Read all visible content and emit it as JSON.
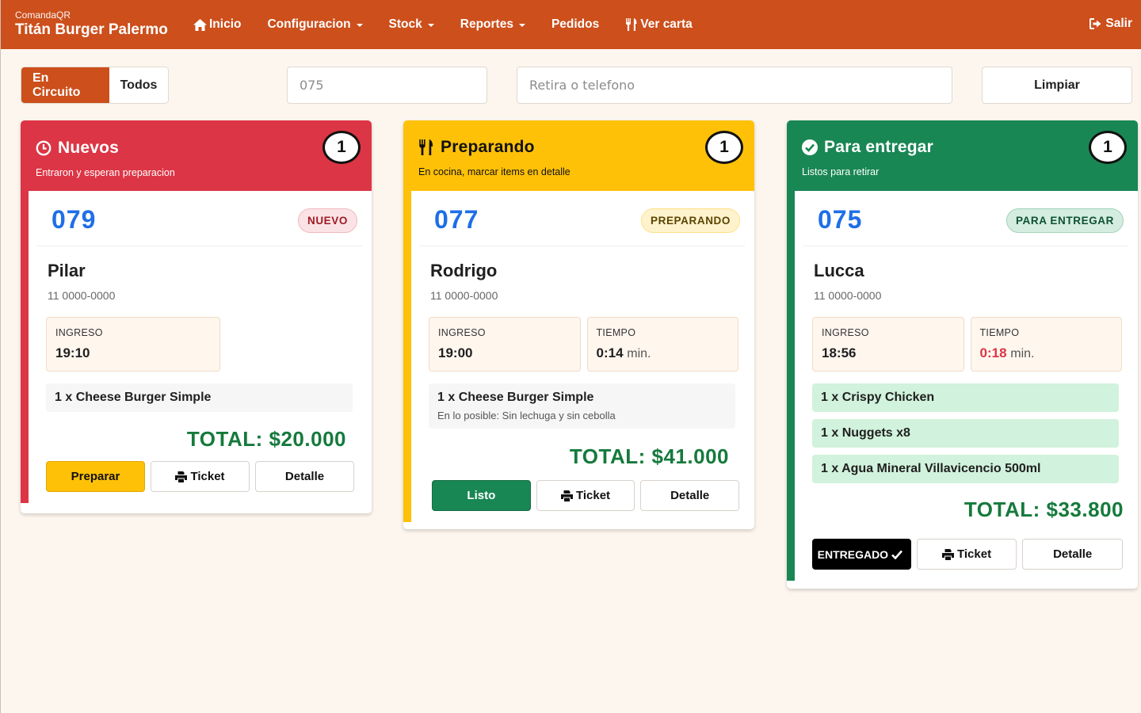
{
  "app": {
    "subtitle": "ComandaQR",
    "title": "Titán Burger Palermo"
  },
  "nav": {
    "items": [
      {
        "label": "Inicio",
        "icon": "home-icon"
      },
      {
        "label": "Configuracion",
        "dropdown": true
      },
      {
        "label": "Stock",
        "dropdown": true
      },
      {
        "label": "Reportes",
        "dropdown": true
      },
      {
        "label": "Pedidos"
      },
      {
        "label": "Ver carta",
        "icon": "cutlery-icon"
      }
    ],
    "logout": "Salir"
  },
  "filters": {
    "tabs": [
      {
        "label": "En Circuito",
        "active": true
      },
      {
        "label": "Todos",
        "active": false
      }
    ],
    "order_search": {
      "value": "",
      "placeholder": "075"
    },
    "phone_search": {
      "value": "",
      "placeholder": "Retira o telefono"
    },
    "clear_label": "Limpiar"
  },
  "colors": {
    "brand": "#cc4f1c",
    "nuevos": "#dc3545",
    "preparando": "#ffc107",
    "para_entregar": "#198754",
    "order_number": "#1e6fe6",
    "total": "#157a3c"
  },
  "columns": [
    {
      "title": "Nuevos",
      "subtitle": "Entraron y esperan preparacion",
      "count": "1",
      "icon": "clock-icon",
      "orders": [
        {
          "number": "079",
          "status": "NUEVO",
          "customer": "Pilar",
          "phone": "11 0000-0000",
          "ingreso_label": "INGRESO",
          "ingreso": "19:10",
          "items": [
            {
              "text": "1 x Cheese Burger Simple"
            }
          ],
          "total": "TOTAL: $20.000",
          "actions": {
            "primary": "Preparar",
            "ticket": "Ticket",
            "detail": "Detalle"
          }
        }
      ]
    },
    {
      "title": "Preparando",
      "subtitle": "En cocina, marcar items en detalle",
      "count": "1",
      "icon": "cutlery-icon",
      "orders": [
        {
          "number": "077",
          "status": "PREPARANDO",
          "customer": "Rodrigo",
          "phone": "11 0000-0000",
          "ingreso_label": "INGRESO",
          "ingreso": "19:00",
          "tiempo_label": "TIEMPO",
          "tiempo": "0:14",
          "tiempo_unit": "min.",
          "items": [
            {
              "text": "1 x Cheese Burger Simple",
              "note": "En lo posible: Sin lechuga y sin cebolla"
            }
          ],
          "total": "TOTAL: $41.000",
          "actions": {
            "primary": "Listo",
            "ticket": "Ticket",
            "detail": "Detalle"
          }
        }
      ]
    },
    {
      "title": "Para entregar",
      "subtitle": "Listos para retirar",
      "count": "1",
      "icon": "check-circle-icon",
      "orders": [
        {
          "number": "075",
          "status": "PARA ENTREGAR",
          "customer": "Lucca",
          "phone": "11 0000-0000",
          "ingreso_label": "INGRESO",
          "ingreso": "18:56",
          "tiempo_label": "TIEMPO",
          "tiempo": "0:18",
          "tiempo_unit": "min.",
          "items": [
            {
              "text": "1 x Crispy Chicken"
            },
            {
              "text": "1 x Nuggets x8"
            },
            {
              "text": "1 x Agua Mineral Villavicencio 500ml"
            }
          ],
          "total": "TOTAL: $33.800",
          "actions": {
            "primary": "ENTREGADO",
            "ticket": "Ticket",
            "detail": "Detalle"
          }
        }
      ]
    }
  ]
}
